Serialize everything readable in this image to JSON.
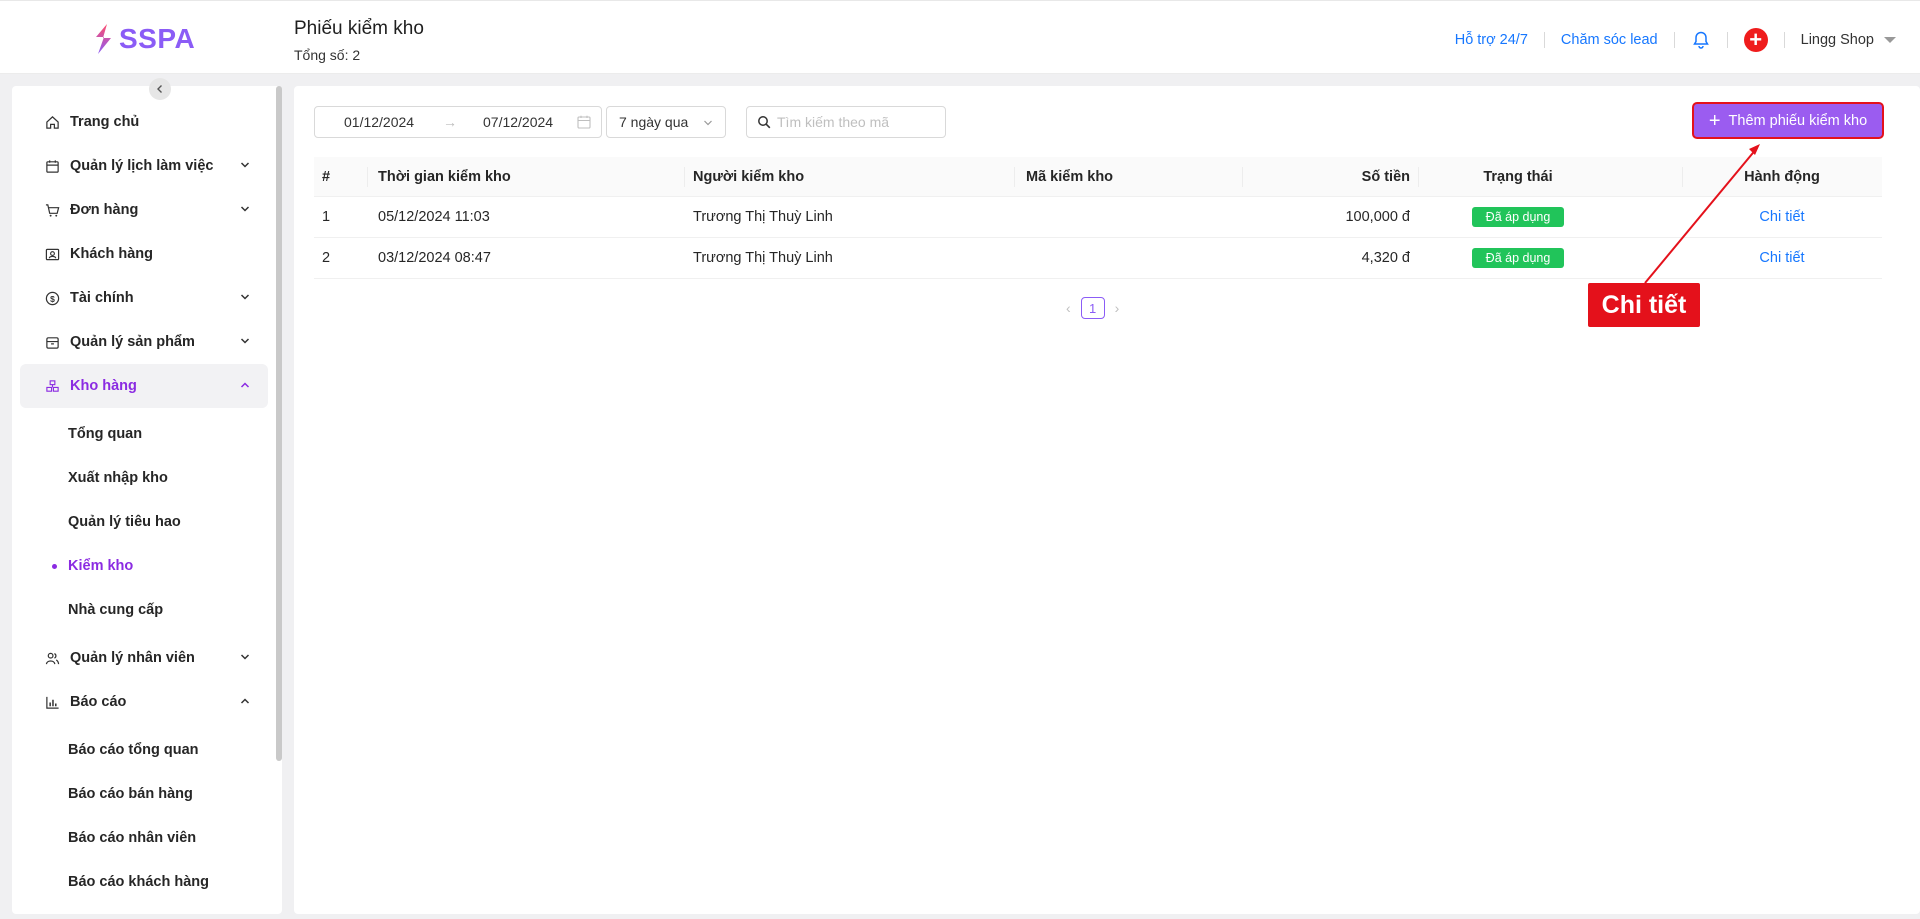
{
  "brand": {
    "logo_text": "SSPA",
    "accent": "#8b5cf6"
  },
  "header": {
    "title": "Phiếu kiểm kho",
    "subtitle": "Tổng số: 2",
    "support_link": "Hỗ trợ 24/7",
    "lead_link": "Chăm sóc lead",
    "user_name": "Lingg Shop"
  },
  "sidebar": {
    "items": [
      {
        "label": "Trang chủ",
        "icon": "home-icon"
      },
      {
        "label": "Quản lý lịch làm việc",
        "icon": "calendar-icon"
      },
      {
        "label": "Đơn hàng",
        "icon": "cart-icon"
      },
      {
        "label": "Khách hàng",
        "icon": "contact-card-icon"
      },
      {
        "label": "Tài chính",
        "icon": "dollar-circle-icon"
      },
      {
        "label": "Quản lý sản phẩm",
        "icon": "box-icon"
      },
      {
        "label": "Kho hàng",
        "icon": "warehouse-icon"
      },
      {
        "label": "Quản lý nhân viên",
        "icon": "users-icon"
      },
      {
        "label": "Báo cáo",
        "icon": "bar-chart-icon"
      }
    ],
    "warehouse_sub": [
      "Tổng quan",
      "Xuất nhập kho",
      "Quản lý tiêu hao",
      "Kiểm kho",
      "Nhà cung cấp"
    ],
    "report_sub": [
      "Báo cáo tổng quan",
      "Báo cáo bán hàng",
      "Báo cáo nhân viên",
      "Báo cáo khách hàng"
    ]
  },
  "filters": {
    "date_start": "01/12/2024",
    "date_end": "07/12/2024",
    "date_arrow": "→",
    "preset": "7 ngày qua",
    "search_placeholder": "Tìm kiếm theo mã"
  },
  "actions": {
    "add_label": "Thêm phiếu kiểm kho"
  },
  "table": {
    "columns": [
      "#",
      "Thời gian kiểm kho",
      "Người kiểm kho",
      "Mã kiểm kho",
      "Số tiền",
      "Trạng thái",
      "Hành động"
    ],
    "rows": [
      {
        "index": "1",
        "time": "05/12/2024 11:03",
        "person": "Trương Thị Thuỳ Linh",
        "code": "",
        "amount": "100,000 đ",
        "status": "Đã áp dụng",
        "action": "Chi tiết"
      },
      {
        "index": "2",
        "time": "03/12/2024 08:47",
        "person": "Trương Thị Thuỳ Linh",
        "code": "",
        "amount": "4,320 đ",
        "status": "Đã áp dụng",
        "action": "Chi tiết"
      }
    ]
  },
  "pagination": {
    "current": "1"
  },
  "annotation": {
    "label": "Chi tiết",
    "color": "#e4111b"
  }
}
